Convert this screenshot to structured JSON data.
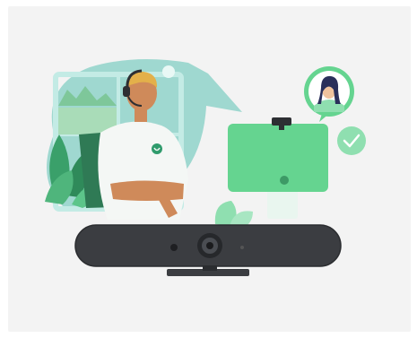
{
  "scene": {
    "subject": "video-conferencing-illustration",
    "colors": {
      "background": "#f3f3f3",
      "bubble": "#9fd8d0",
      "accent_green": "#65d490",
      "mint": "#8fdfb0",
      "device_dark": "#3b3d41",
      "skin": "#cf8a5a",
      "hair": "#e3b04a",
      "shirt": "#f4f7f5",
      "dark_green": "#2f7a55"
    }
  }
}
